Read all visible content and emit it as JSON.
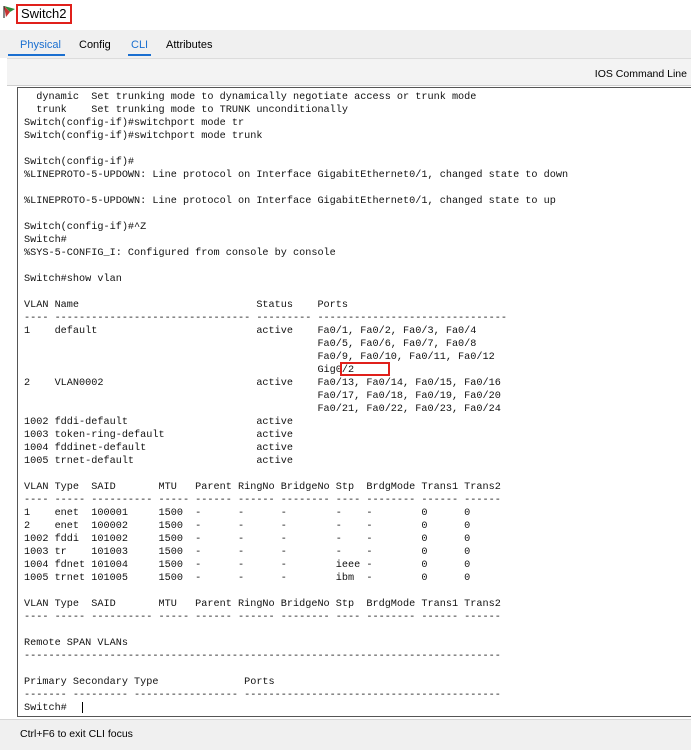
{
  "window": {
    "title": "Switch2",
    "icon": "switch-device-icon"
  },
  "tabs": [
    {
      "label": "Physical",
      "active": true
    },
    {
      "label": "Config",
      "active": false
    },
    {
      "label": "CLI",
      "active": true
    },
    {
      "label": "Attributes",
      "active": false
    }
  ],
  "panel": {
    "title": "IOS Command Line"
  },
  "cli": {
    "text": "  dynamic  Set trunking mode to dynamically negotiate access or trunk mode\n  trunk    Set trunking mode to TRUNK unconditionally\nSwitch(config-if)#switchport mode tr\nSwitch(config-if)#switchport mode trunk\n\nSwitch(config-if)#\n%LINEPROTO-5-UPDOWN: Line protocol on Interface GigabitEthernet0/1, changed state to down\n\n%LINEPROTO-5-UPDOWN: Line protocol on Interface GigabitEthernet0/1, changed state to up\n\nSwitch(config-if)#^Z\nSwitch#\n%SYS-5-CONFIG_I: Configured from console by console\n\nSwitch#show vlan\n\nVLAN Name                             Status    Ports\n---- -------------------------------- --------- -------------------------------\n1    default                          active    Fa0/1, Fa0/2, Fa0/3, Fa0/4\n                                                Fa0/5, Fa0/6, Fa0/7, Fa0/8\n                                                Fa0/9, Fa0/10, Fa0/11, Fa0/12\n                                                Gig0/2\n2    VLAN0002                         active    Fa0/13, Fa0/14, Fa0/15, Fa0/16\n                                                Fa0/17, Fa0/18, Fa0/19, Fa0/20\n                                                Fa0/21, Fa0/22, Fa0/23, Fa0/24\n1002 fddi-default                     active\n1003 token-ring-default               active\n1004 fddinet-default                  active\n1005 trnet-default                    active\n\nVLAN Type  SAID       MTU   Parent RingNo BridgeNo Stp  BrdgMode Trans1 Trans2\n---- ----- ---------- ----- ------ ------ -------- ---- -------- ------ ------\n1    enet  100001     1500  -      -      -        -    -        0      0\n2    enet  100002     1500  -      -      -        -    -        0      0\n1002 fddi  101002     1500  -      -      -        -    -        0      0\n1003 tr    101003     1500  -      -      -        -    -        0      0\n1004 fdnet 101004     1500  -      -      -        ieee -        0      0\n1005 trnet 101005     1500  -      -      -        ibm  -        0      0\n\nVLAN Type  SAID       MTU   Parent RingNo BridgeNo Stp  BrdgMode Trans1 Trans2\n---- ----- ---------- ----- ------ ------ -------- ---- -------- ------ ------\n\nRemote SPAN VLANs\n------------------------------------------------------------------------------\n\nPrimary Secondary Type              Ports\n------- --------- ----------------- ------------------------------------------\nSwitch#"
  },
  "statusbar": {
    "hint": "Ctrl+F6 to exit CLI focus"
  },
  "colors": {
    "accent": "#1a6fd0",
    "highlight": "#e0201b"
  }
}
